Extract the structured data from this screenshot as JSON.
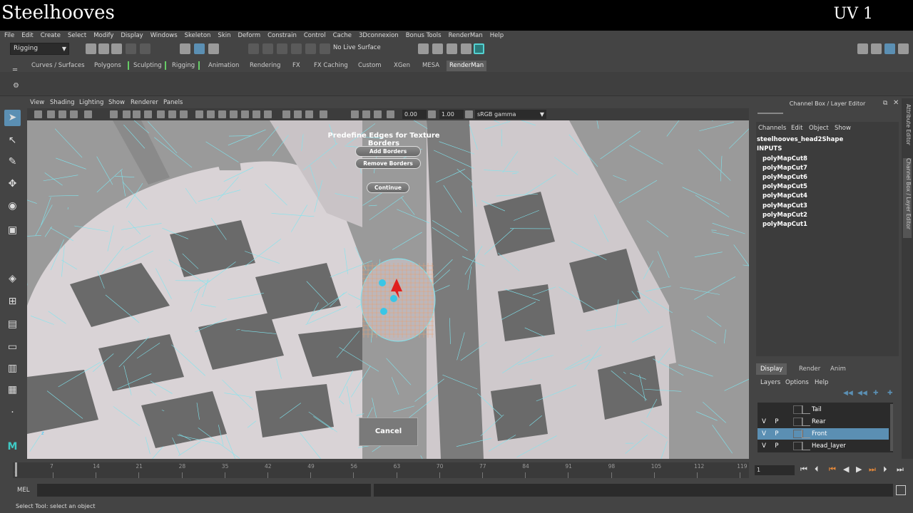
{
  "video_title": {
    "left": "Steelhooves",
    "right": "UV 1"
  },
  "menu": [
    "File",
    "Edit",
    "Create",
    "Select",
    "Modify",
    "Display",
    "Windows",
    "Skeleton",
    "Skin",
    "Deform",
    "Constrain",
    "Control",
    "Cache",
    "3Dconnexion",
    "Bonus Tools",
    "RenderMan",
    "Help"
  ],
  "status": {
    "mode": "Rigging",
    "live_surface": "No Live Surface"
  },
  "shelf_tabs": [
    "Curves / Surfaces",
    "Polygons",
    "Sculpting",
    "Rigging",
    "Animation",
    "Rendering",
    "FX",
    "FX Caching",
    "Custom",
    "XGen",
    "MESA",
    "RenderMan"
  ],
  "shelf_active": "RenderMan",
  "panel_menu": [
    "View",
    "Shading",
    "Lighting",
    "Show",
    "Renderer",
    "Panels"
  ],
  "panel_toolbar": {
    "exposure": "0.00",
    "gamma": "1.00",
    "color_space": "sRGB gamma"
  },
  "viewport": {
    "prompt_title": "Predefine Edges for Texture Borders",
    "add_borders": "Add Borders",
    "remove_borders": "Remove Borders",
    "continue": "Continue",
    "cancel": "Cancel",
    "colors": {
      "wireframe": "#7fe6f0",
      "dark_patch": "#6a6a6a",
      "light_patch": "#ece7ea"
    }
  },
  "channel_box": {
    "header": "Channel Box / Layer Editor",
    "menu": [
      "Channels",
      "Edit",
      "Object",
      "Show"
    ],
    "shape": "steelhooves_head2Shape",
    "inputs_label": "INPUTS",
    "inputs": [
      "polyMapCut8",
      "polyMapCut7",
      "polyMapCut6",
      "polyMapCut5",
      "polyMapCut4",
      "polyMapCut3",
      "polyMapCut2",
      "polyMapCut1"
    ]
  },
  "layer_editor": {
    "tabs": [
      "Display",
      "Render",
      "Anim"
    ],
    "active_tab": "Display",
    "menu": [
      "Layers",
      "Options",
      "Help"
    ],
    "layers": [
      {
        "v": "",
        "p": "",
        "name": "Tail",
        "selected": false
      },
      {
        "v": "V",
        "p": "P",
        "name": "Rear",
        "selected": false
      },
      {
        "v": "V",
        "p": "P",
        "name": "Front",
        "selected": true
      },
      {
        "v": "V",
        "p": "P",
        "name": "Head_layer",
        "selected": false
      }
    ]
  },
  "side_tabs": [
    "Attribute Editor",
    "Channel Box / Layer Editor"
  ],
  "timeline": {
    "ticks": [
      "7",
      "14",
      "21",
      "28",
      "35",
      "42",
      "49",
      "56",
      "63",
      "70",
      "77",
      "84",
      "91",
      "98",
      "105",
      "112",
      "119"
    ],
    "start": "1",
    "current_frame": "1"
  },
  "command_line": {
    "label": "MEL"
  },
  "help_line": "Select Tool: select an object",
  "colors": {
    "accent": "#5b8fb3",
    "title_bg": "#000000",
    "ui_bg": "#444444"
  }
}
